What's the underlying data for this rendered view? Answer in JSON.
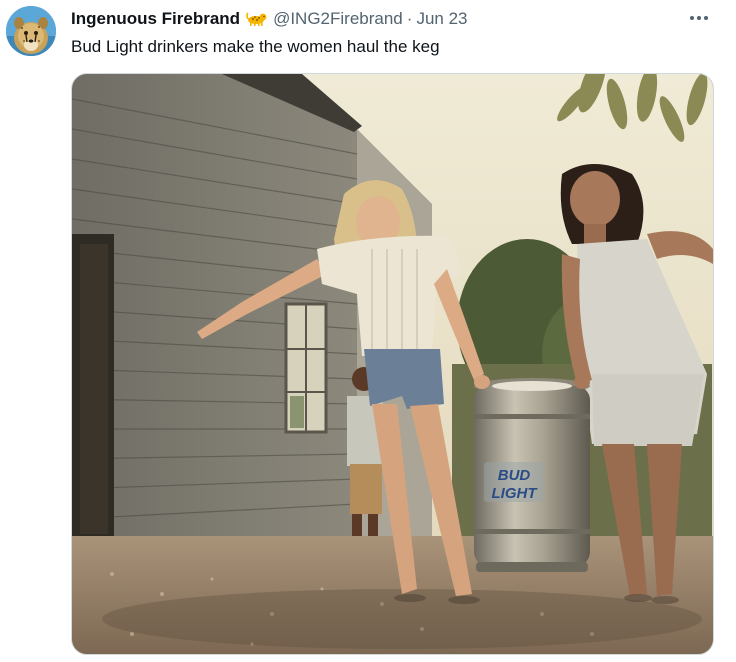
{
  "author": {
    "display_name": "Ingenuous Firebrand",
    "badge_icon": "leopard-emoji-icon",
    "handle": "@ING2Firebrand",
    "separator": "·",
    "date": "Jun 23"
  },
  "tweet": {
    "text": "Bud Light drinkers make the women haul the keg"
  },
  "media": {
    "keg_label_line1": "BUD",
    "keg_label_line2": "LIGHT"
  },
  "colors": {
    "text_primary": "#0f1419",
    "text_secondary": "#536471",
    "border": "#cfd9de"
  }
}
